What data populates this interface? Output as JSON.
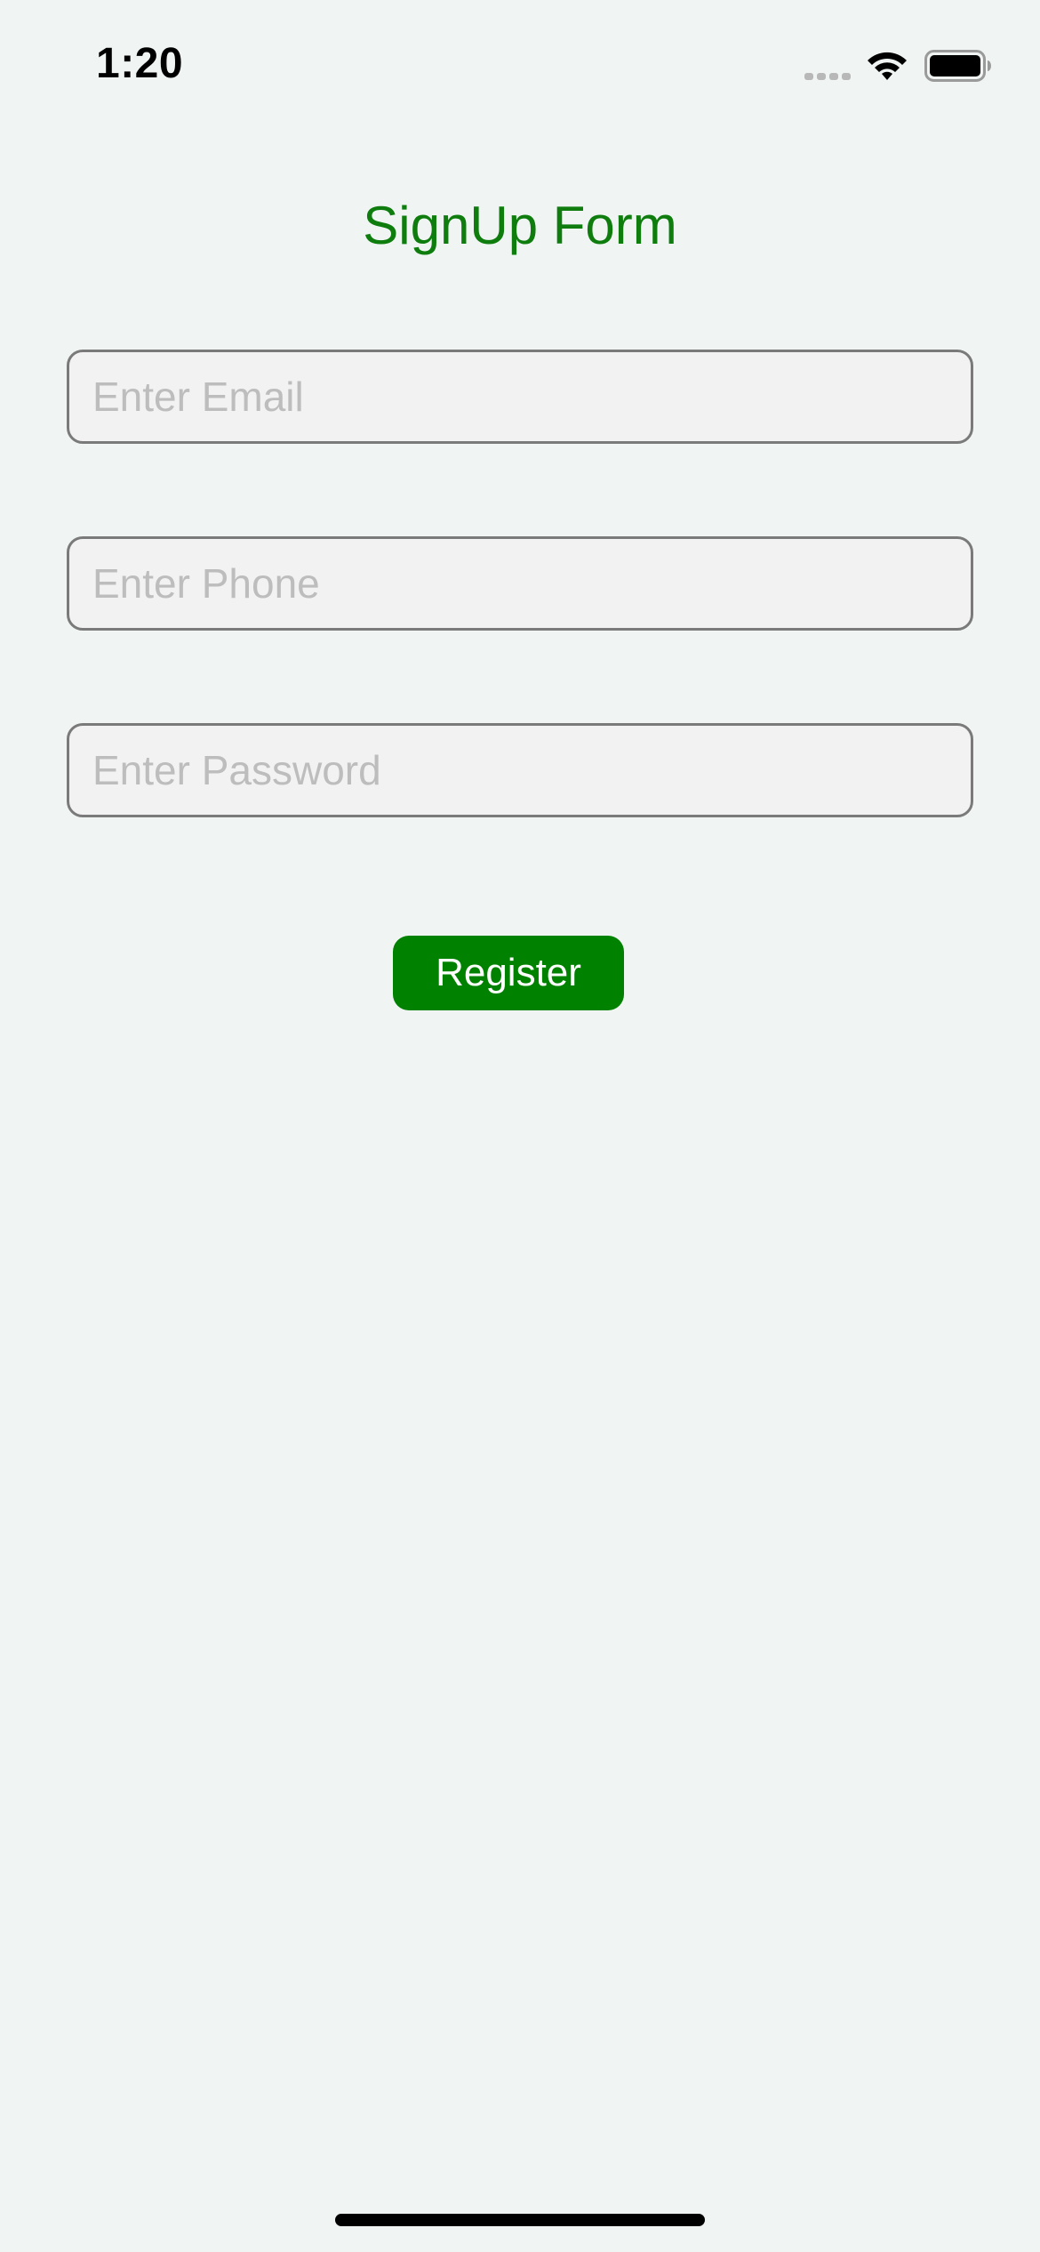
{
  "status_bar": {
    "time": "1:20",
    "icons": [
      "signal-icon",
      "wifi-icon",
      "battery-icon"
    ]
  },
  "form": {
    "title": "SignUp Form",
    "email": {
      "value": "",
      "placeholder": "Enter Email"
    },
    "phone": {
      "value": "",
      "placeholder": "Enter Phone"
    },
    "password": {
      "value": "",
      "placeholder": "Enter Password"
    },
    "register_label": "Register"
  },
  "colors": {
    "background": "#f0f5f3",
    "title": "#0e7d0e",
    "button": "#008200",
    "field_border": "#7a7a7a",
    "placeholder": "#bdbdbd"
  }
}
